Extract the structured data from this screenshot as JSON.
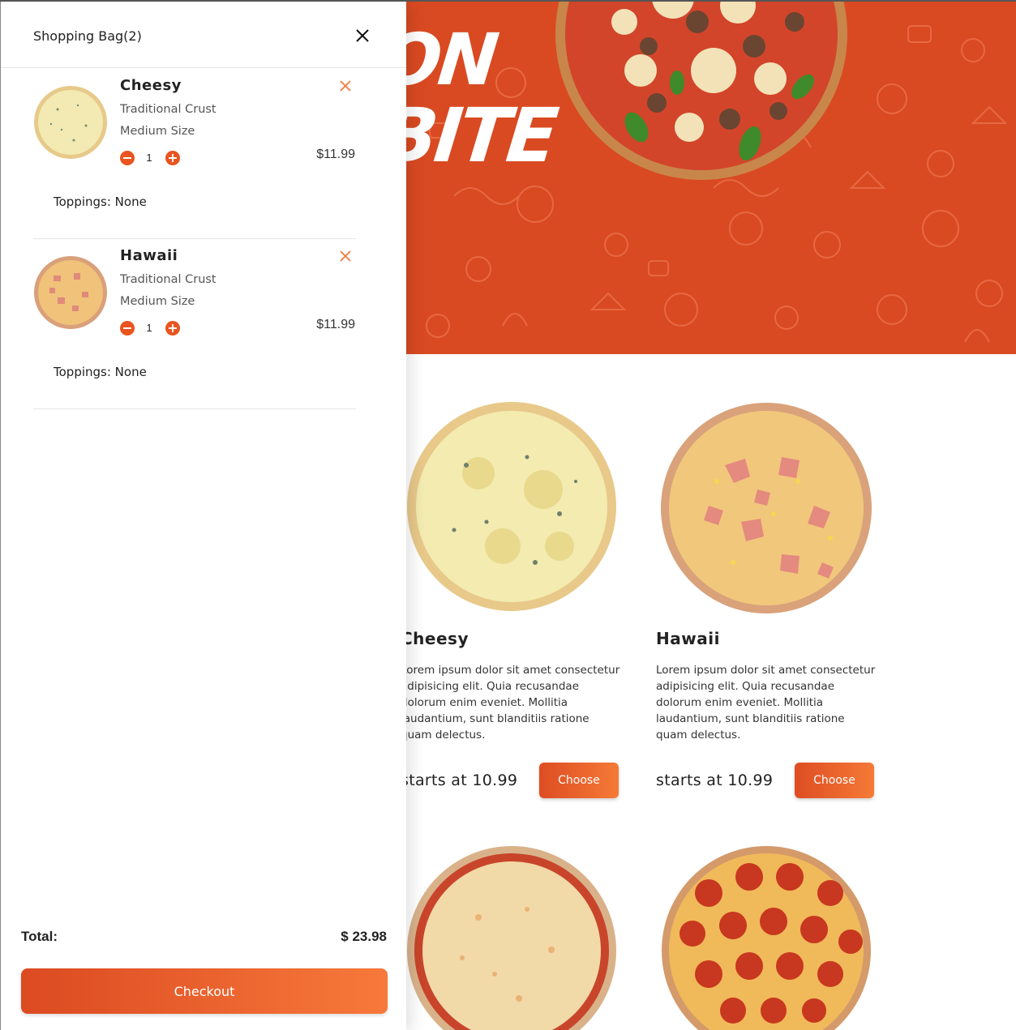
{
  "colors": {
    "accent": "#e9541f",
    "hero_bg": "#d94a22",
    "button_gradient_start": "#de4d22",
    "button_gradient_end": "#f57a36"
  },
  "hero": {
    "line1": "ON",
    "line2": "BITE"
  },
  "menu": {
    "cards": [
      {
        "title": "Cheesy",
        "description": "Lorem ipsum dolor sit amet consectetur adipisicing elit. Quia recusandae dolorum enim eveniet. Mollitia laudantium, sunt blanditiis ratione quam delectus.",
        "price": "starts at 10.99",
        "button": "Choose"
      },
      {
        "title": "Hawaii",
        "description": "Lorem ipsum dolor sit amet consectetur adipisicing elit. Quia recusandae dolorum enim eveniet. Mollitia laudantium, sunt blanditiis ratione quam delectus.",
        "price": "starts at 10.99",
        "button": "Choose"
      }
    ]
  },
  "bag": {
    "title": "Shopping Bag(2)",
    "close_icon": "close-icon",
    "items": [
      {
        "name": "Cheesy",
        "crust": "Traditional Crust",
        "size": "Medium Size",
        "quantity": "1",
        "price": "$11.99",
        "toppings": "Toppings: None"
      },
      {
        "name": "Hawaii",
        "crust": "Traditional Crust",
        "size": "Medium Size",
        "quantity": "1",
        "price": "$11.99",
        "toppings": "Toppings: None"
      }
    ],
    "total_label": "Total:",
    "total_value": "$ 23.98",
    "checkout_label": "Checkout"
  }
}
